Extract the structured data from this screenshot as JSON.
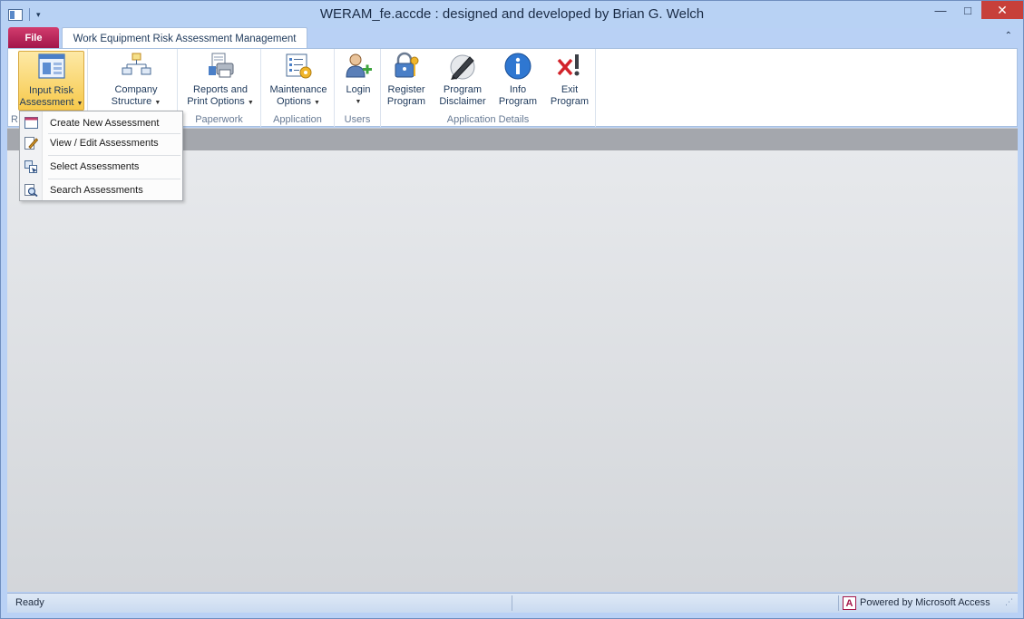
{
  "window": {
    "title": "WERAM_fe.accde : designed and developed by Brian G. Welch",
    "controls": {
      "minimize": "—",
      "maximize": "□",
      "close": "✕"
    }
  },
  "ribbon": {
    "file_tab": "File",
    "active_tab": "Work Equipment Risk Assessment Management",
    "collapse_glyph": "⌃",
    "groups": [
      {
        "label": "R",
        "buttons": [
          {
            "line1": "Input Risk",
            "line2": "Assessment",
            "icon": "form-window-icon",
            "has_dropdown": true,
            "active": true
          }
        ]
      },
      {
        "label": "",
        "buttons": [
          {
            "line1": "Company",
            "line2": "Structure",
            "icon": "org-chart-icon",
            "has_dropdown": true
          }
        ]
      },
      {
        "label": "Paperwork",
        "buttons": [
          {
            "line1": "Reports and",
            "line2": "Print Options",
            "icon": "printer-icon",
            "has_dropdown": true
          }
        ]
      },
      {
        "label": "Application",
        "buttons": [
          {
            "line1": "Maintenance",
            "line2": "Options",
            "icon": "checklist-gear-icon",
            "has_dropdown": true
          }
        ]
      },
      {
        "label": "Users",
        "buttons": [
          {
            "line1": "Login",
            "line2": "",
            "icon": "user-add-icon",
            "has_dropdown": true
          }
        ]
      },
      {
        "label": "Application Details",
        "buttons": [
          {
            "line1": "Register",
            "line2": "Program",
            "icon": "lock-key-icon"
          },
          {
            "line1": "Program",
            "line2": "Disclaimer",
            "icon": "pen-signature-icon"
          },
          {
            "line1": "Info",
            "line2": "Program",
            "icon": "info-icon"
          },
          {
            "line1": "Exit",
            "line2": "Program",
            "icon": "exit-x-icon"
          }
        ]
      }
    ]
  },
  "menu": {
    "items": [
      {
        "label": "Create New Assessment",
        "icon": "new-form-icon"
      },
      {
        "label": "View / Edit Assessments",
        "icon": "edit-icon"
      },
      {
        "label": "Select Assessments",
        "icon": "select-icon"
      },
      {
        "label": "Search Assessments",
        "icon": "search-icon"
      }
    ]
  },
  "status": {
    "ready": "Ready",
    "powered_by": "Powered by Microsoft Access",
    "access_badge": "A"
  },
  "colors": {
    "frame": "#b9d1f5",
    "file_tab": "#b3245a",
    "active_button": "#f7c94b",
    "close_button": "#c7403a"
  }
}
